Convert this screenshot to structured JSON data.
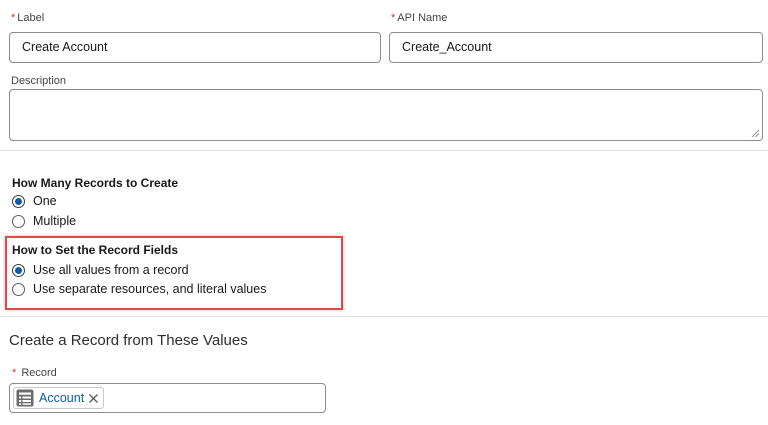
{
  "form": {
    "required_mark": "*",
    "label": {
      "title": "Label",
      "value": "Create Account"
    },
    "api_name": {
      "title": "API Name",
      "value": "Create_Account"
    },
    "description": {
      "title": "Description",
      "value": ""
    }
  },
  "how_many": {
    "title": "How Many Records to Create",
    "options": [
      {
        "label": "One",
        "selected": true
      },
      {
        "label": "Multiple",
        "selected": false
      }
    ]
  },
  "how_to_set": {
    "title": "How to Set the Record Fields",
    "options": [
      {
        "label": "Use all values from a record",
        "selected": true
      },
      {
        "label": "Use separate resources, and literal values",
        "selected": false
      }
    ]
  },
  "record_section": {
    "title": "Create a Record from These Values",
    "record_label": "Record",
    "pill_text": "Account",
    "pill_icon": "record-list-icon",
    "pill_remove_icon": "close-icon"
  },
  "colors": {
    "required": "#c23934",
    "radio_selected": "#0b5cab",
    "highlight_border": "#e0484d",
    "pill_text": "#0b5cab"
  }
}
